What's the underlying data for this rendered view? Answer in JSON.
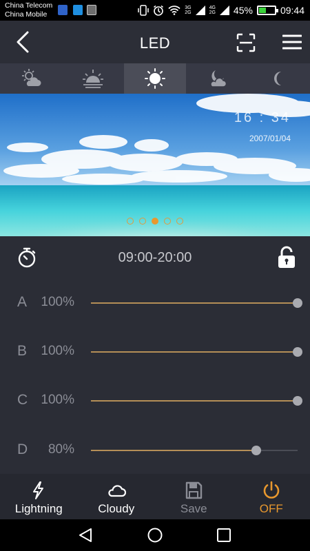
{
  "status_bar": {
    "carrier1": "China Telecom",
    "carrier2": "China Mobile",
    "net1": "3G",
    "net1b": "2G",
    "net2": "4G",
    "net2b": "2G",
    "battery": "45%",
    "battery_level": 0.45,
    "clock": "09:44"
  },
  "header": {
    "title": "LED"
  },
  "tabs": [
    {
      "icon": "cloudy-sun-icon",
      "active": false
    },
    {
      "icon": "sunrise-icon",
      "active": false
    },
    {
      "icon": "sun-icon",
      "active": true
    },
    {
      "icon": "cloud-moon-icon",
      "active": false
    },
    {
      "icon": "moon-icon",
      "active": false
    }
  ],
  "hero": {
    "time": "16 : 34",
    "date": "2007/01/04",
    "active_page": 3,
    "page_count": 5
  },
  "schedule": {
    "time_range": "09:00-20:00"
  },
  "channels": [
    {
      "letter": "A",
      "value": "100%",
      "level": 1.0
    },
    {
      "letter": "B",
      "value": "100%",
      "level": 1.0
    },
    {
      "letter": "C",
      "value": "100%",
      "level": 1.0
    },
    {
      "letter": "D",
      "value": "80%",
      "level": 0.8
    }
  ],
  "toolbar": {
    "lightning": "Lightning",
    "cloudy": "Cloudy",
    "save": "Save",
    "off": "OFF"
  },
  "colors": {
    "accent": "#e8982e",
    "slider_fill": "#b58f57",
    "disabled": "#8b8d96"
  }
}
